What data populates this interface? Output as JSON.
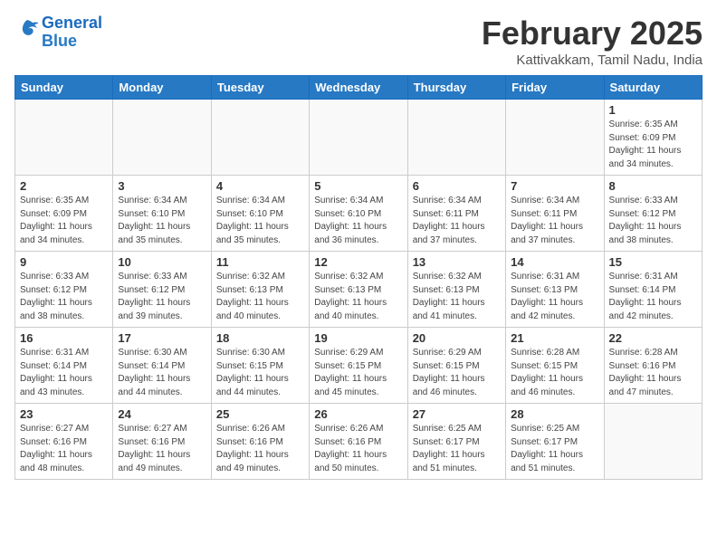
{
  "header": {
    "logo_line1": "General",
    "logo_line2": "Blue",
    "title": "February 2025",
    "subtitle": "Kattivakkam, Tamil Nadu, India"
  },
  "days_of_week": [
    "Sunday",
    "Monday",
    "Tuesday",
    "Wednesday",
    "Thursday",
    "Friday",
    "Saturday"
  ],
  "weeks": [
    [
      {
        "day": "",
        "info": ""
      },
      {
        "day": "",
        "info": ""
      },
      {
        "day": "",
        "info": ""
      },
      {
        "day": "",
        "info": ""
      },
      {
        "day": "",
        "info": ""
      },
      {
        "day": "",
        "info": ""
      },
      {
        "day": "1",
        "info": "Sunrise: 6:35 AM\nSunset: 6:09 PM\nDaylight: 11 hours\nand 34 minutes."
      }
    ],
    [
      {
        "day": "2",
        "info": "Sunrise: 6:35 AM\nSunset: 6:09 PM\nDaylight: 11 hours\nand 34 minutes."
      },
      {
        "day": "3",
        "info": "Sunrise: 6:34 AM\nSunset: 6:10 PM\nDaylight: 11 hours\nand 35 minutes."
      },
      {
        "day": "4",
        "info": "Sunrise: 6:34 AM\nSunset: 6:10 PM\nDaylight: 11 hours\nand 35 minutes."
      },
      {
        "day": "5",
        "info": "Sunrise: 6:34 AM\nSunset: 6:10 PM\nDaylight: 11 hours\nand 36 minutes."
      },
      {
        "day": "6",
        "info": "Sunrise: 6:34 AM\nSunset: 6:11 PM\nDaylight: 11 hours\nand 37 minutes."
      },
      {
        "day": "7",
        "info": "Sunrise: 6:34 AM\nSunset: 6:11 PM\nDaylight: 11 hours\nand 37 minutes."
      },
      {
        "day": "8",
        "info": "Sunrise: 6:33 AM\nSunset: 6:12 PM\nDaylight: 11 hours\nand 38 minutes."
      }
    ],
    [
      {
        "day": "9",
        "info": "Sunrise: 6:33 AM\nSunset: 6:12 PM\nDaylight: 11 hours\nand 38 minutes."
      },
      {
        "day": "10",
        "info": "Sunrise: 6:33 AM\nSunset: 6:12 PM\nDaylight: 11 hours\nand 39 minutes."
      },
      {
        "day": "11",
        "info": "Sunrise: 6:32 AM\nSunset: 6:13 PM\nDaylight: 11 hours\nand 40 minutes."
      },
      {
        "day": "12",
        "info": "Sunrise: 6:32 AM\nSunset: 6:13 PM\nDaylight: 11 hours\nand 40 minutes."
      },
      {
        "day": "13",
        "info": "Sunrise: 6:32 AM\nSunset: 6:13 PM\nDaylight: 11 hours\nand 41 minutes."
      },
      {
        "day": "14",
        "info": "Sunrise: 6:31 AM\nSunset: 6:13 PM\nDaylight: 11 hours\nand 42 minutes."
      },
      {
        "day": "15",
        "info": "Sunrise: 6:31 AM\nSunset: 6:14 PM\nDaylight: 11 hours\nand 42 minutes."
      }
    ],
    [
      {
        "day": "16",
        "info": "Sunrise: 6:31 AM\nSunset: 6:14 PM\nDaylight: 11 hours\nand 43 minutes."
      },
      {
        "day": "17",
        "info": "Sunrise: 6:30 AM\nSunset: 6:14 PM\nDaylight: 11 hours\nand 44 minutes."
      },
      {
        "day": "18",
        "info": "Sunrise: 6:30 AM\nSunset: 6:15 PM\nDaylight: 11 hours\nand 44 minutes."
      },
      {
        "day": "19",
        "info": "Sunrise: 6:29 AM\nSunset: 6:15 PM\nDaylight: 11 hours\nand 45 minutes."
      },
      {
        "day": "20",
        "info": "Sunrise: 6:29 AM\nSunset: 6:15 PM\nDaylight: 11 hours\nand 46 minutes."
      },
      {
        "day": "21",
        "info": "Sunrise: 6:28 AM\nSunset: 6:15 PM\nDaylight: 11 hours\nand 46 minutes."
      },
      {
        "day": "22",
        "info": "Sunrise: 6:28 AM\nSunset: 6:16 PM\nDaylight: 11 hours\nand 47 minutes."
      }
    ],
    [
      {
        "day": "23",
        "info": "Sunrise: 6:27 AM\nSunset: 6:16 PM\nDaylight: 11 hours\nand 48 minutes."
      },
      {
        "day": "24",
        "info": "Sunrise: 6:27 AM\nSunset: 6:16 PM\nDaylight: 11 hours\nand 49 minutes."
      },
      {
        "day": "25",
        "info": "Sunrise: 6:26 AM\nSunset: 6:16 PM\nDaylight: 11 hours\nand 49 minutes."
      },
      {
        "day": "26",
        "info": "Sunrise: 6:26 AM\nSunset: 6:16 PM\nDaylight: 11 hours\nand 50 minutes."
      },
      {
        "day": "27",
        "info": "Sunrise: 6:25 AM\nSunset: 6:17 PM\nDaylight: 11 hours\nand 51 minutes."
      },
      {
        "day": "28",
        "info": "Sunrise: 6:25 AM\nSunset: 6:17 PM\nDaylight: 11 hours\nand 51 minutes."
      },
      {
        "day": "",
        "info": ""
      }
    ]
  ]
}
